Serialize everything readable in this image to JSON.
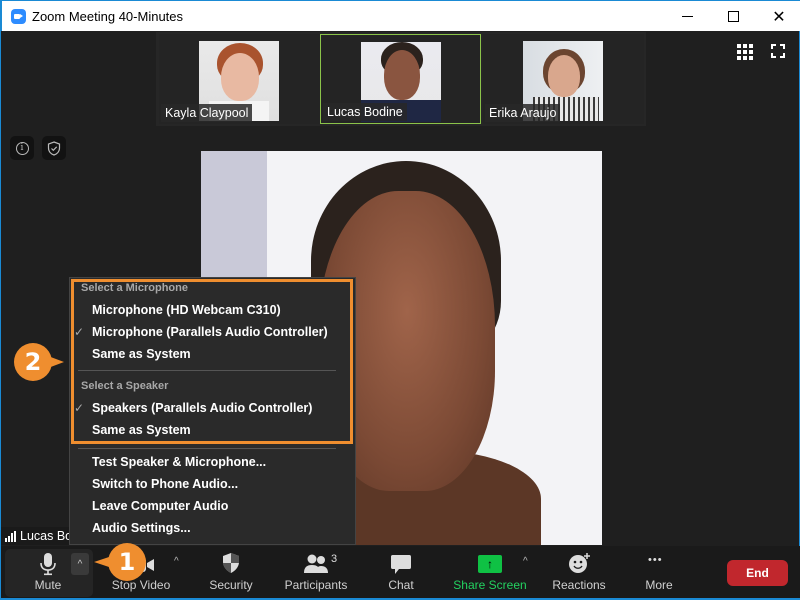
{
  "window": {
    "title": "Zoom Meeting 40-Minutes",
    "controls": {
      "minimize": "minimize",
      "maximize": "maximize",
      "close": "✕"
    }
  },
  "gallery": {
    "participants": [
      {
        "name": "Kayla Claypool",
        "active": false
      },
      {
        "name": "Lucas Bodine",
        "active": true
      },
      {
        "name": "Erika Araujo",
        "active": false
      }
    ]
  },
  "view_controls": {
    "gallery_view": "grid-icon",
    "fullscreen": "fullscreen-icon"
  },
  "meeting_info": {
    "info_glyph": "i",
    "security_badge": "shield-check-icon"
  },
  "main_video": {
    "speaker": "Lucas Bodine"
  },
  "self_view": {
    "label": "Lucas Bodine"
  },
  "audio_menu": {
    "microphone_header": "Select a Microphone",
    "microphones": [
      {
        "label": "Microphone (HD Webcam C310)",
        "checked": false
      },
      {
        "label": "Microphone (Parallels Audio Controller)",
        "checked": true
      },
      {
        "label": "Same as System",
        "checked": false
      }
    ],
    "speaker_header": "Select a Speaker",
    "speakers": [
      {
        "label": "Speakers (Parallels Audio Controller)",
        "checked": true
      },
      {
        "label": "Same as System",
        "checked": false
      }
    ],
    "actions": [
      "Test Speaker & Microphone...",
      "Switch to Phone Audio...",
      "Leave Computer Audio",
      "Audio Settings..."
    ],
    "check_glyph": "✓"
  },
  "callouts": {
    "step1": "1",
    "step2": "2",
    "accent": "#ef8e2f"
  },
  "toolbar": {
    "mute": "Mute",
    "stop_video": "Stop Video",
    "security": "Security",
    "participants": "Participants",
    "participants_count": "3",
    "chat": "Chat",
    "share_screen": "Share Screen",
    "reactions": "Reactions",
    "more": "More",
    "end": "End",
    "caret": "^",
    "share_arrow": "↑",
    "more_glyph": "•••"
  },
  "colors": {
    "share_green": "#0fc144",
    "end_red": "#c1272d",
    "active_border": "#8bc34a"
  }
}
